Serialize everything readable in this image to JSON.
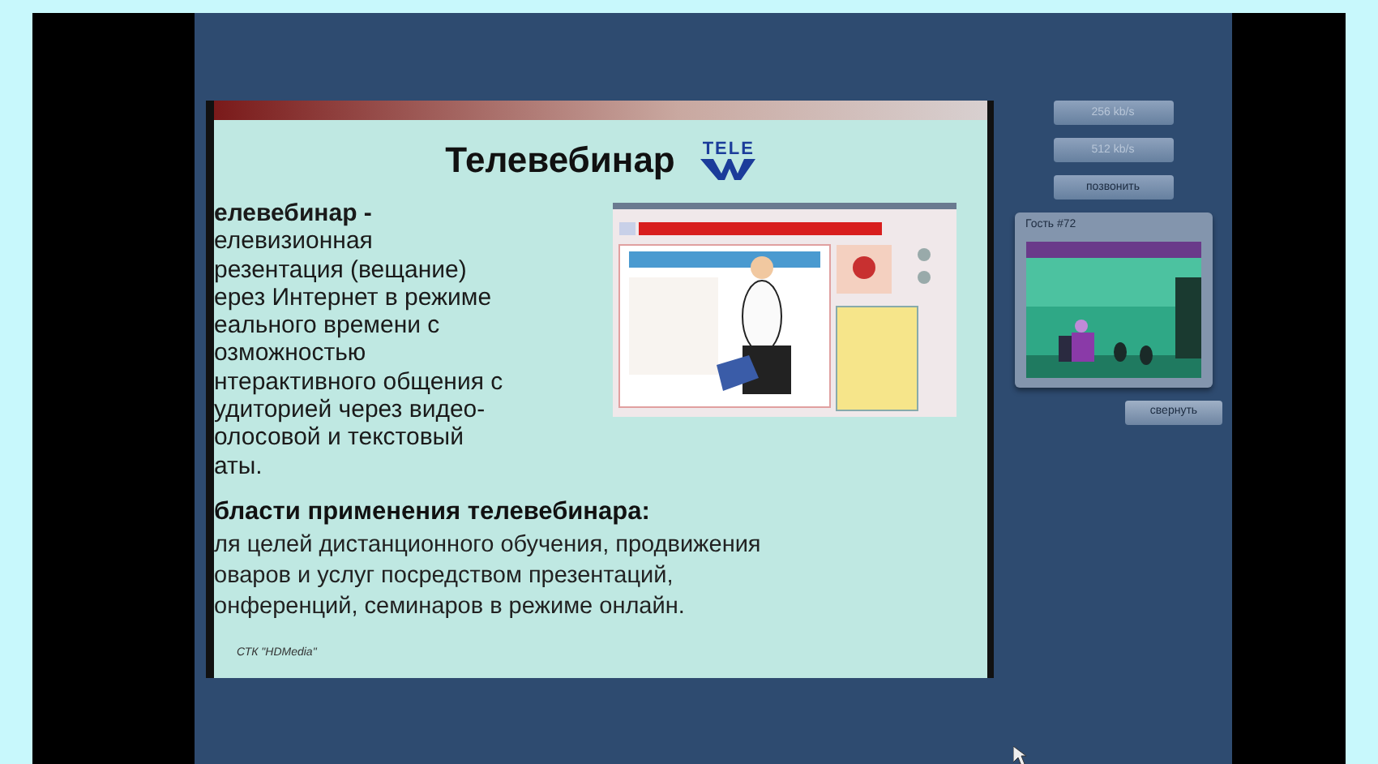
{
  "slide": {
    "title": "Телевебинар",
    "logo_text": "TELE",
    "definition_lines": [
      "елевебинар -",
      "елевизионная",
      "резентация (вещание)",
      "ерез Интернет в режиме",
      "еального времени с",
      "озможностью",
      "нтерактивного общения с",
      "удиторией через видео-",
      "олосовой и текстовый",
      "аты."
    ],
    "areas_heading": "бласти применения телевебинара:",
    "areas_lines": [
      "ля целей дистанционного обучения, продвижения",
      "оваров и услуг посредством презентаций,",
      "онференций, семинаров в режиме онлайн."
    ],
    "footer": "СТК \"HDMedia\""
  },
  "bitrate_buttons": [
    {
      "label": "256 kb/s",
      "disabled": true
    },
    {
      "label": "512 kb/s",
      "disabled": true
    }
  ],
  "call_button": {
    "label": "позвонить"
  },
  "guest_panel": {
    "title": "Гость #72"
  },
  "collapse_button": {
    "label": "свернуть"
  }
}
